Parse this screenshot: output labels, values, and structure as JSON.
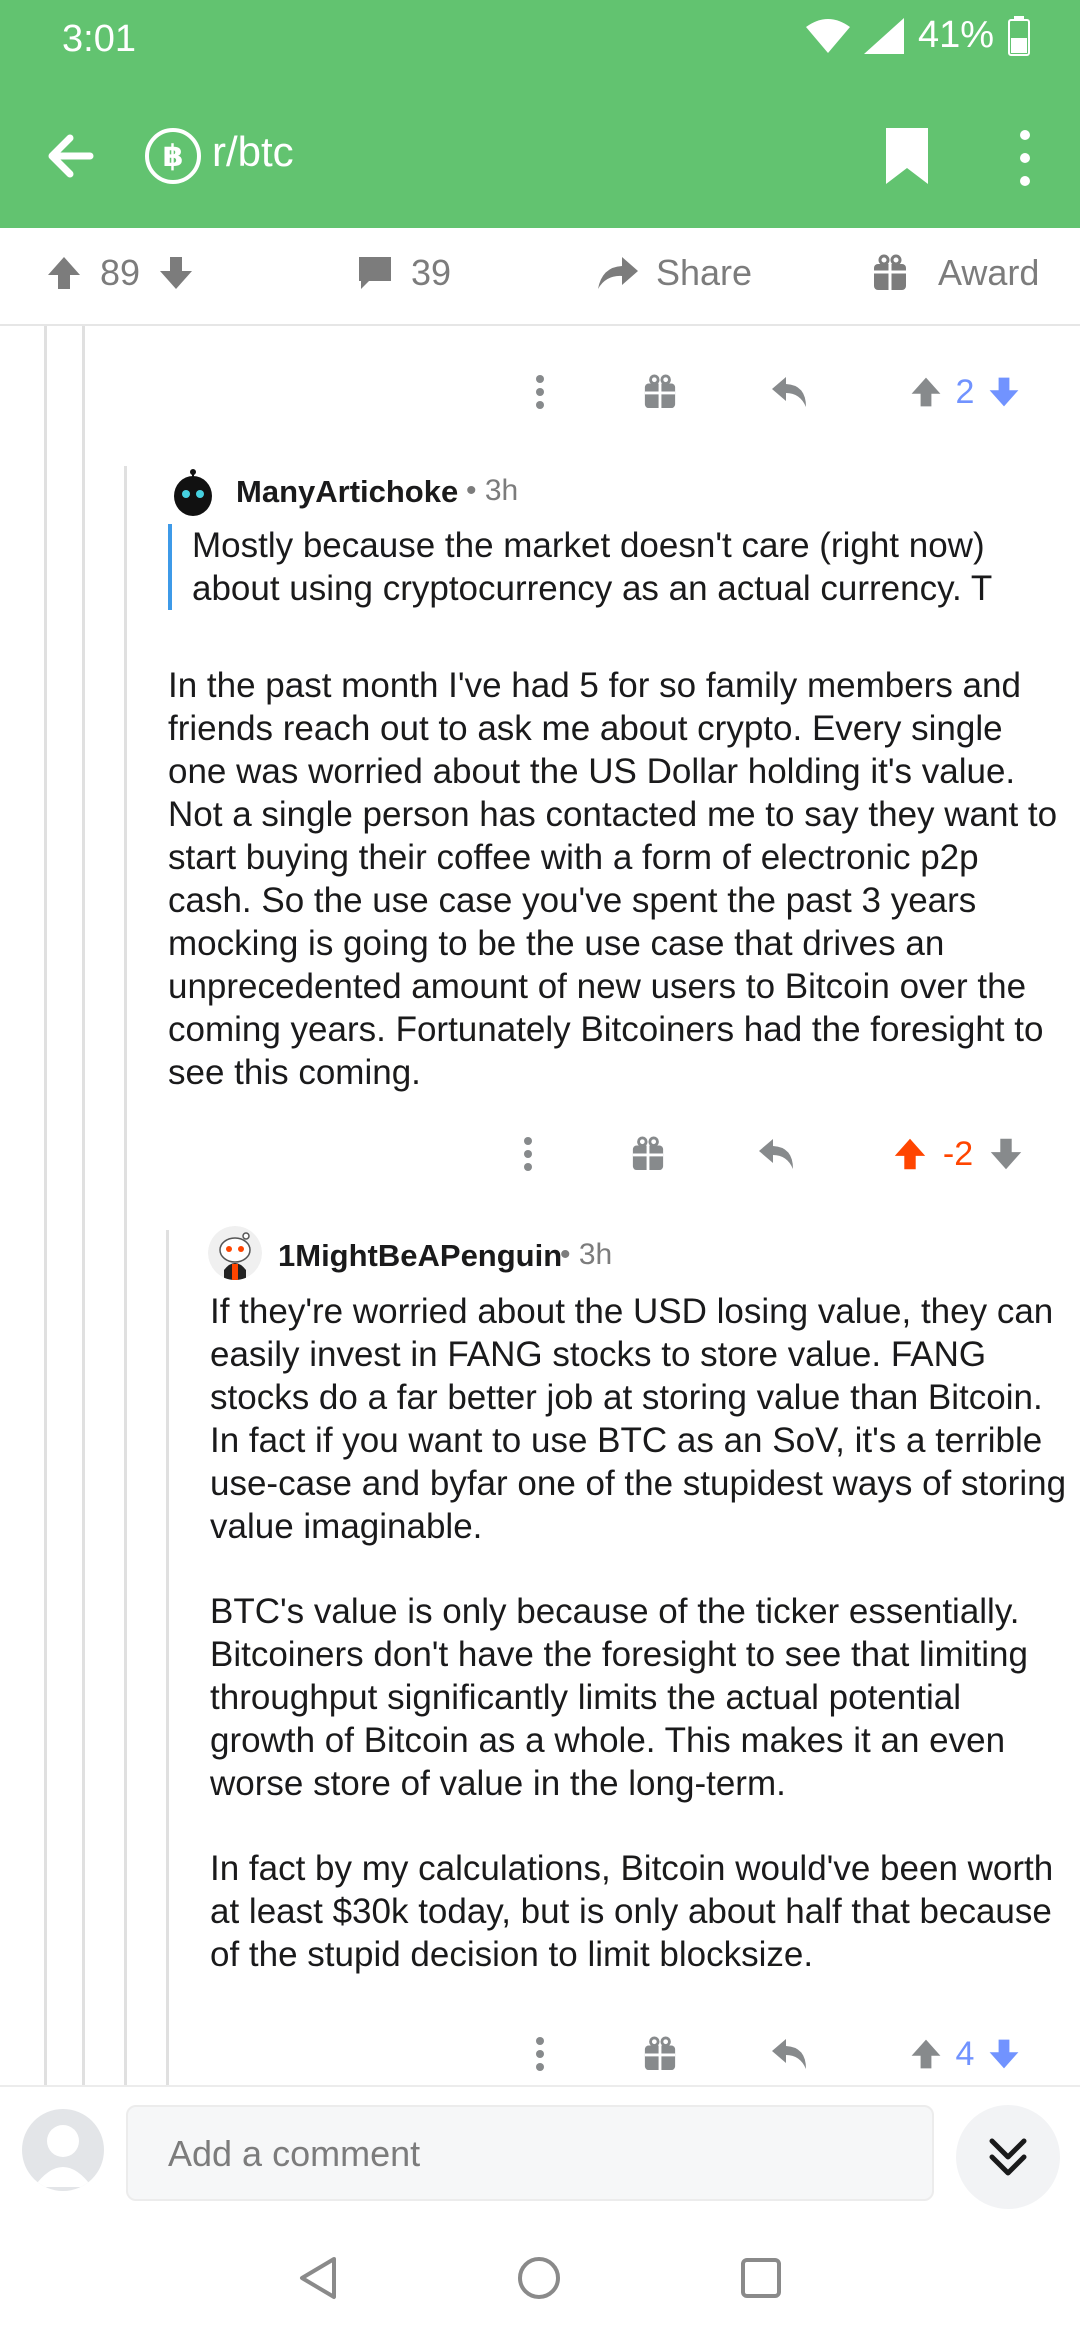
{
  "status": {
    "time": "3:01",
    "battery": "41%"
  },
  "header": {
    "subreddit": "r/btc",
    "sub_icon_glyph": "฿"
  },
  "post_actions": {
    "upvotes": "89",
    "comments": "39",
    "share": "Share",
    "award": "Award"
  },
  "comments": [
    {
      "id": "top-partial",
      "votes": "2",
      "vote_state": "neutral"
    },
    {
      "id": "c1",
      "username": "ManyArtichoke",
      "time": "3h",
      "quote": "Mostly because the market doesn't care (right now) about using cryptocurrency as an actual currency. T",
      "paragraphs": [
        "In the past month I've had 5 for so family members and friends reach out to ask me about crypto. Every single one was worried about the US Dollar holding it's value. Not a single person has contacted me to say they want to start buying their coffee with a form of electronic p2p cash. So the use case you've spent the past 3 years mocking is going to be the use case that drives an unprecedented amount of new users to Bitcoin over the coming years. Fortunately Bitcoiners had the foresight to see this coming."
      ],
      "votes": "-2",
      "vote_state": "upvoted"
    },
    {
      "id": "c2",
      "username": "1MightBeAPenguin",
      "time": "3h",
      "paragraphs": [
        "If they're worried about the USD losing value, they can easily invest in FANG stocks to store value. FANG stocks do a far better job at storing value than Bitcoin. In fact if you want to use BTC as an SoV, it's a terrible use-case and byfar one of the stupidest ways of storing value imaginable.",
        "BTC's value is only because of the ticker essentially. Bitcoiners don't have the foresight to see that limiting throughput significantly limits the actual potential growth of Bitcoin as a whole. This makes it an even worse store of value in the long-term.",
        "In fact by my calculations, Bitcoin would've been worth at least $30k today, but is only about half that because of the stupid decision to limit blocksize."
      ],
      "votes": "4",
      "vote_state": "neutral"
    }
  ],
  "comment_bar": {
    "placeholder": "Add a comment"
  },
  "colors": {
    "header": "#62c370",
    "upvote": "#ff4500",
    "downvote": "#7193ff",
    "quote_bar": "#3e9ae8"
  },
  "icons": [
    "back-arrow-icon",
    "bitcoin-icon",
    "bookmark-icon",
    "overflow-icon",
    "upvote-icon",
    "downvote-icon",
    "comment-icon",
    "share-icon",
    "gift-icon",
    "reply-icon",
    "more-icon",
    "chevron-double-down-icon"
  ]
}
